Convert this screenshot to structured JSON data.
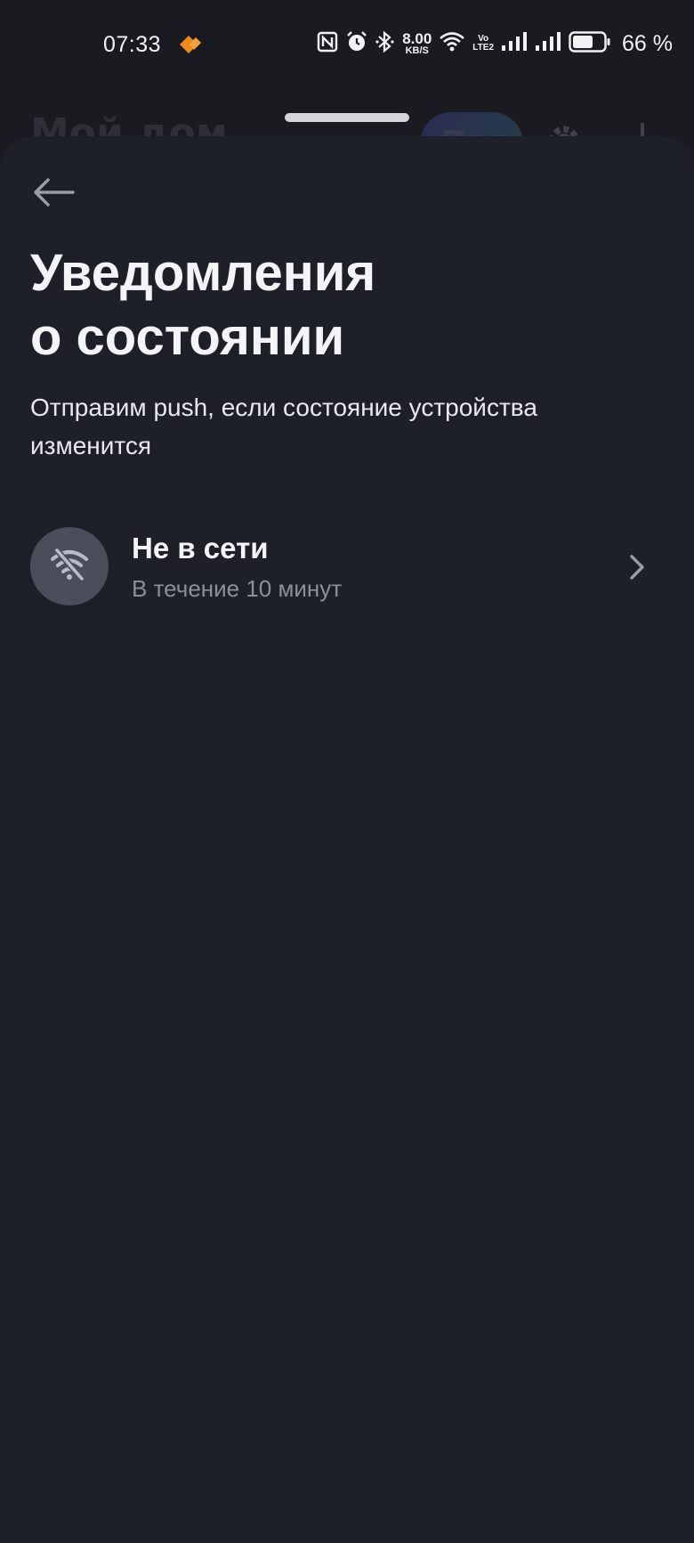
{
  "status_bar": {
    "time": "07:33",
    "net_speed_value": "8.00",
    "net_speed_unit": "KB/S",
    "volte_top": "Vo",
    "volte_bottom": "LTE2",
    "battery_percent": "66 %",
    "battery_level": 0.66
  },
  "background_app": {
    "title": "Мой дом",
    "pill_label": "Про"
  },
  "sheet": {
    "title_line1": "Уведомления",
    "title_line2": "о состоянии",
    "subtitle": "Отправим push, если состояние устройства изменится",
    "items": [
      {
        "icon": "wifi-off-icon",
        "title": "Не в сети",
        "subtitle": "В течение 10 минут"
      }
    ]
  },
  "colors": {
    "sheet_background": "#1e2029",
    "icon_circle": "#4a4d5a",
    "secondary_text": "#8c8f9b",
    "status_app_accent": "#f08a1c"
  }
}
